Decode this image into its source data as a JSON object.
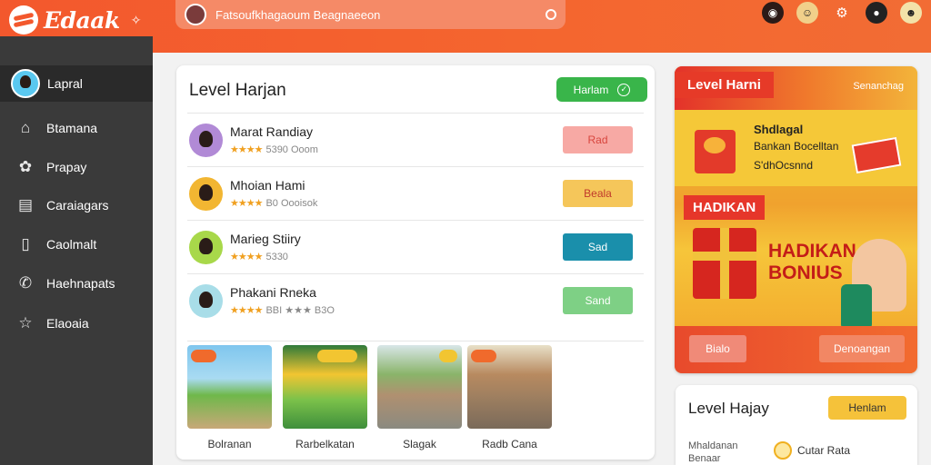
{
  "app": {
    "logo_text": "Edaak"
  },
  "search": {
    "text": "Fatsoufkhagaoum Beagnaeeon"
  },
  "sidebar": {
    "items": [
      {
        "label": "Lapral",
        "icon": "user-avatar"
      },
      {
        "label": "Btamana",
        "icon": "home-icon"
      },
      {
        "label": "Prapay",
        "icon": "game-icon"
      },
      {
        "label": "Caraiagars",
        "icon": "cards-icon"
      },
      {
        "label": "Caolmalt",
        "icon": "bookmark-icon"
      },
      {
        "label": "Haehnapats",
        "icon": "phone-icon"
      },
      {
        "label": "Elaoaia",
        "icon": "star-icon"
      }
    ]
  },
  "main": {
    "title": "Level Harjan",
    "action_label": "Harlam",
    "rows": [
      {
        "name": "Marat Randiay",
        "stars": "★★★★",
        "meta": "5390 Ooom",
        "button": "Rad",
        "btn_bg": "#f7a9a4",
        "btn_color": "#d8463e",
        "avatar_bg": "#b18ad6"
      },
      {
        "name": "Mhoian Hami",
        "stars": "★★★★",
        "meta": "B0 Oooisok",
        "button": "Beala",
        "btn_bg": "#f5c65a",
        "btn_color": "#c0392b",
        "avatar_bg": "#f2b632"
      },
      {
        "name": "Marieg Stiiry",
        "stars": "★★★★",
        "meta": "5330",
        "button": "Sad",
        "btn_bg": "#1a8fab",
        "btn_color": "#ffffff",
        "avatar_bg": "#a8d84a"
      },
      {
        "name": "Phakani Rneka",
        "stars": "★★★★",
        "meta": "BBI ★★★ B3O",
        "button": "Sand",
        "btn_bg": "#7ed085",
        "btn_color": "#ffffff",
        "avatar_bg": "#a8dde8"
      }
    ],
    "thumbs": [
      {
        "caption": "Bolranan"
      },
      {
        "caption": "Rarbelkatan"
      },
      {
        "caption": "Slagak"
      },
      {
        "caption": "Radb Cana"
      }
    ]
  },
  "promo": {
    "header": "Level Harni",
    "header_link": "Senanchag",
    "line1": "Shdlagal",
    "line2": "Bankan Bocelltan",
    "line3": "S'dhOcsnnd",
    "ribbon": "HADIKAN",
    "bonus_line1": "HADIKAN",
    "bonus_line2": "BONIUS",
    "left_button": "Bialo",
    "right_button": "Denoangan"
  },
  "bottom": {
    "title": "Level Hajay",
    "button": "Henlam",
    "sub_line1": "Mhaldanan",
    "sub_line2": "Benaar",
    "right_text": "Cutar Rata"
  },
  "colors": {
    "accent": "#f3582d",
    "sidebar": "#3a3a3a",
    "green": "#39b54a"
  }
}
